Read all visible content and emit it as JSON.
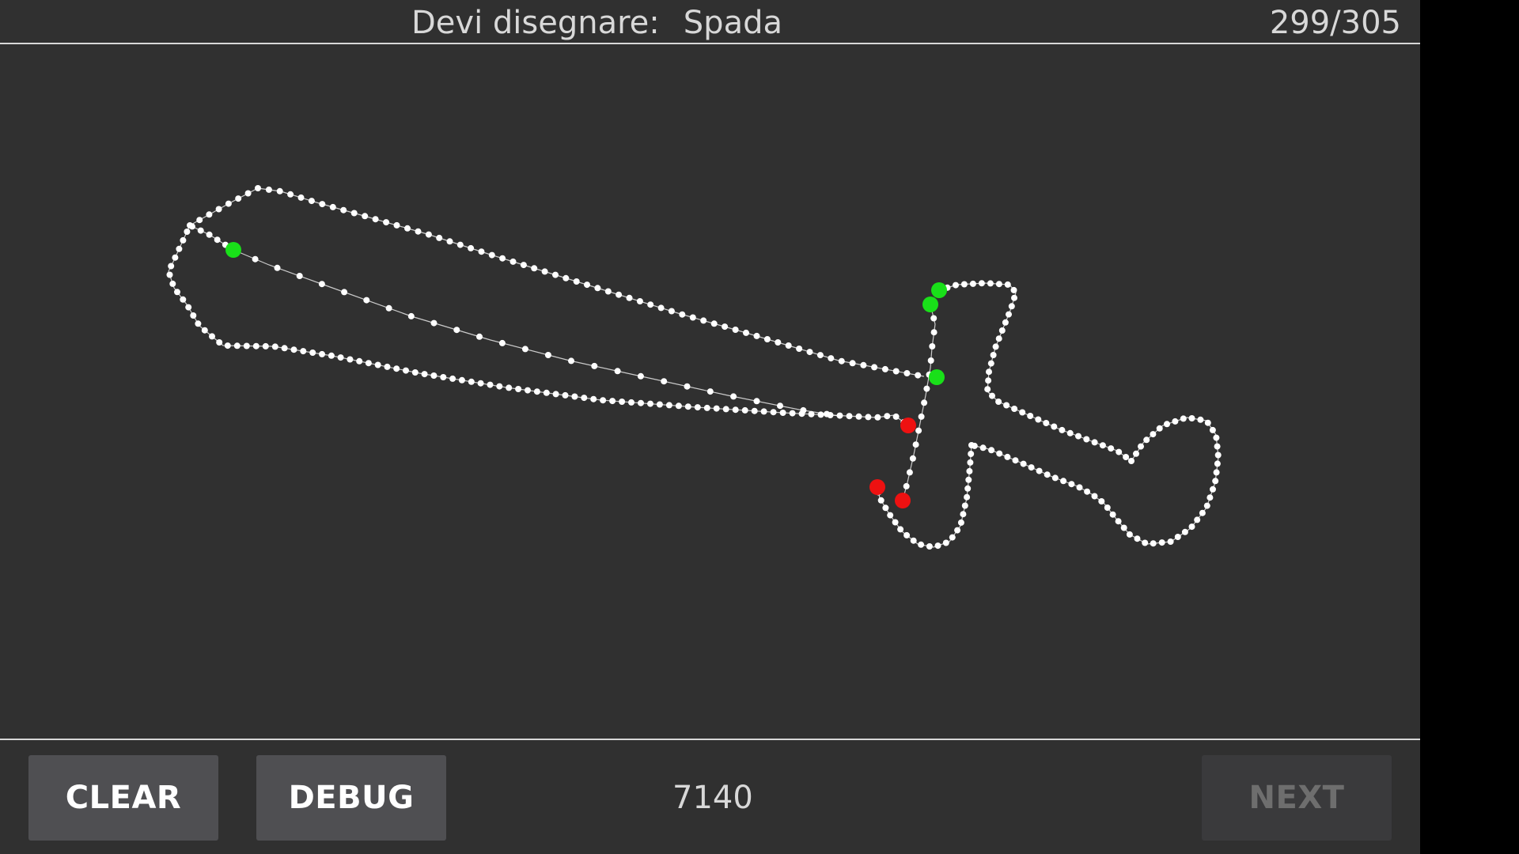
{
  "header": {
    "prompt_label": "Devi disegnare:",
    "target_word": "Spada",
    "progress": "299/305"
  },
  "footer": {
    "clear_label": "CLEAR",
    "debug_label": "DEBUG",
    "score": "7140",
    "next_label": "NEXT"
  },
  "colors": {
    "background": "#303030",
    "stroke": "#ffffff",
    "start_marker": "#19e019",
    "end_marker": "#ee1111"
  }
}
